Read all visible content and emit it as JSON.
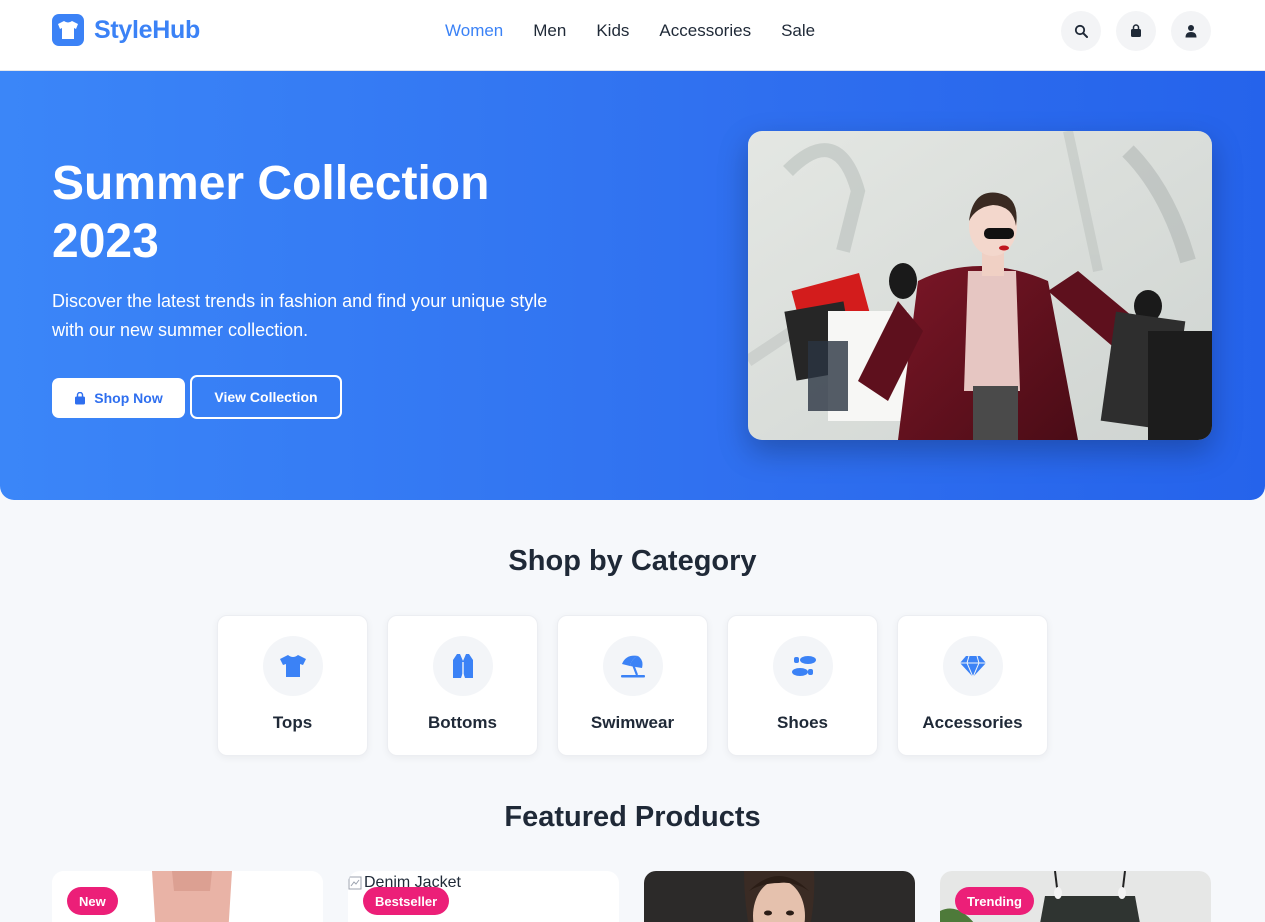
{
  "brand": {
    "name": "StyleHub"
  },
  "nav": [
    {
      "label": "Women",
      "active": true
    },
    {
      "label": "Men",
      "active": false
    },
    {
      "label": "Kids",
      "active": false
    },
    {
      "label": "Accessories",
      "active": false
    },
    {
      "label": "Sale",
      "active": false
    }
  ],
  "header_icons": [
    "search-icon",
    "shopping-bag-icon",
    "user-icon"
  ],
  "hero": {
    "title": "Summer Collection 2023",
    "subtitle": "Discover the latest trends in fashion and find your unique style with our new summer collection.",
    "primary_button": "Shop Now",
    "secondary_button": "View Collection"
  },
  "categories": {
    "title": "Shop by Category",
    "items": [
      {
        "label": "Tops",
        "icon": "tshirt-icon"
      },
      {
        "label": "Bottoms",
        "icon": "vest-icon"
      },
      {
        "label": "Swimwear",
        "icon": "umbrella-beach-icon"
      },
      {
        "label": "Shoes",
        "icon": "shoe-prints-icon"
      },
      {
        "label": "Accessories",
        "icon": "gem-icon"
      }
    ]
  },
  "featured": {
    "title": "Featured Products",
    "products": [
      {
        "badge": "New",
        "image_alt": ""
      },
      {
        "badge": "Bestseller",
        "image_alt": "Denim Jacket"
      },
      {
        "badge": "",
        "image_alt": ""
      },
      {
        "badge": "Trending",
        "image_alt": ""
      }
    ]
  },
  "colors": {
    "primary": "#3b82f6",
    "badge": "#ec1f78",
    "hero_bg": "#2f6fef"
  }
}
